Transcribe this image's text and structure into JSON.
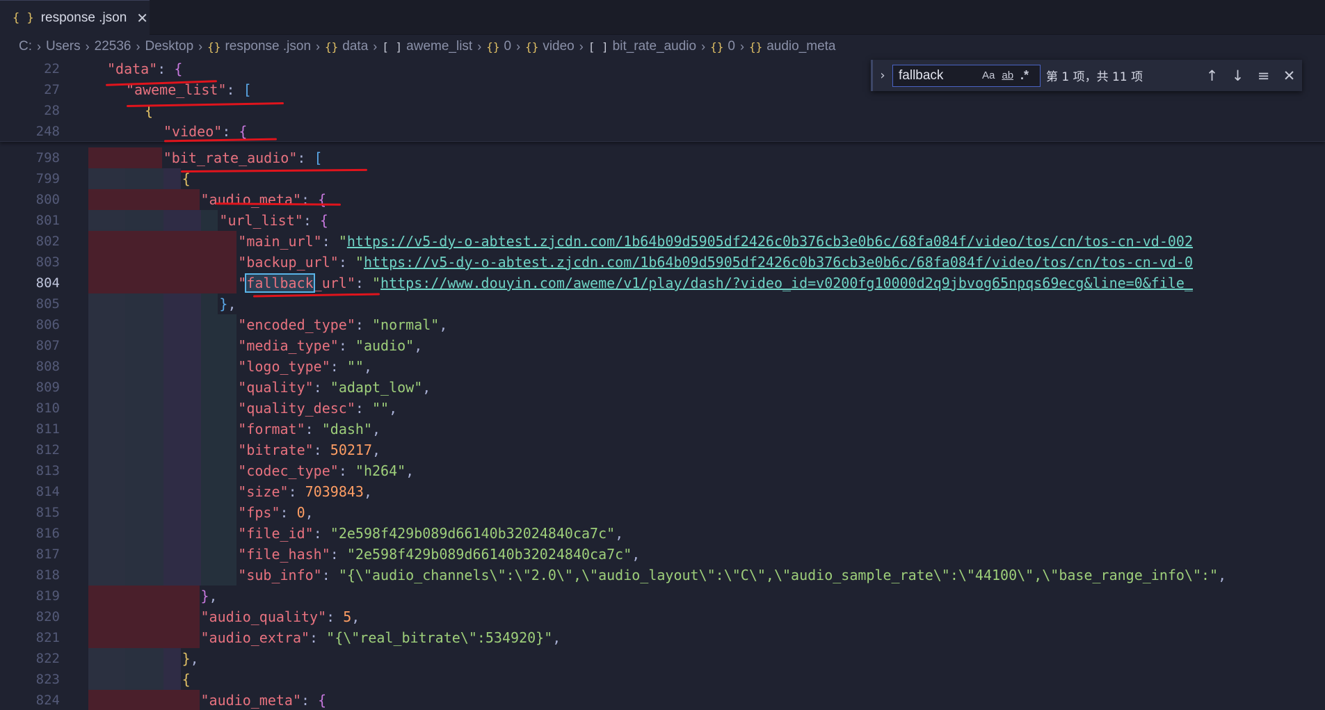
{
  "tab": {
    "title": "response .json",
    "icon": "{ }",
    "close": "✕"
  },
  "breadcrumb": [
    {
      "label": "C:",
      "icon": ""
    },
    {
      "label": "Users",
      "icon": ""
    },
    {
      "label": "22536",
      "icon": ""
    },
    {
      "label": "Desktop",
      "icon": ""
    },
    {
      "label": "response .json",
      "icon": "{}"
    },
    {
      "label": "data",
      "icon": "{}"
    },
    {
      "label": "aweme_list",
      "icon": "[ ]"
    },
    {
      "label": "0",
      "icon": "{}"
    },
    {
      "label": "video",
      "icon": "{}"
    },
    {
      "label": "bit_rate_audio",
      "icon": "[ ]"
    },
    {
      "label": "0",
      "icon": "{}"
    },
    {
      "label": "audio_meta",
      "icon": "{}"
    }
  ],
  "find": {
    "value": "fallback",
    "count": "第 1 项，共 11 项",
    "toggle": "›",
    "match_case": "Aa",
    "whole_word": "ab",
    "regex": ".*",
    "prev": "↑",
    "next": "↓",
    "select_all": "≡",
    "close": "✕"
  },
  "sticky_lines": [
    {
      "num": "22",
      "key": "data",
      "open": "{"
    },
    {
      "num": "27",
      "key": "aweme_list",
      "open": "["
    },
    {
      "num": "28",
      "open": "{"
    },
    {
      "num": "248",
      "key": "video",
      "open": "{"
    }
  ],
  "lines": [
    {
      "num": "798",
      "key": "bit_rate_audio",
      "open": "["
    },
    {
      "num": "799",
      "open": "{"
    },
    {
      "num": "800",
      "key": "audio_meta",
      "open": "{"
    },
    {
      "num": "801",
      "key": "url_list",
      "open": "{"
    },
    {
      "num": "802",
      "key": "main_url",
      "value": "https://v5-dy-o-abtest.zjcdn.com/1b64b09d5905df2426c0b376cb3e0b6c/68fa084f/video/tos/cn/tos-cn-vd-002"
    },
    {
      "num": "803",
      "key": "backup_url",
      "value": "https://v5-dy-o-abtest.zjcdn.com/1b64b09d5905df2426c0b376cb3e0b6c/68fa084f/video/tos/cn/tos-cn-vd-0"
    },
    {
      "num": "804",
      "key_match": "fallback",
      "key_rest": "_url",
      "value": "https://www.douyin.com/aweme/v1/play/dash/?video_id=v0200fg10000d2q9jbvog65npqs69ecg&line=0&file_"
    },
    {
      "num": "805",
      "close": "},"
    },
    {
      "num": "806",
      "key": "encoded_type",
      "value": "normal"
    },
    {
      "num": "807",
      "key": "media_type",
      "value": "audio"
    },
    {
      "num": "808",
      "key": "logo_type",
      "value": ""
    },
    {
      "num": "809",
      "key": "quality",
      "value": "adapt_low"
    },
    {
      "num": "810",
      "key": "quality_desc",
      "value": ""
    },
    {
      "num": "811",
      "key": "format",
      "value": "dash"
    },
    {
      "num": "812",
      "key": "bitrate",
      "number": "50217"
    },
    {
      "num": "813",
      "key": "codec_type",
      "value": "h264"
    },
    {
      "num": "814",
      "key": "size",
      "number": "7039843"
    },
    {
      "num": "815",
      "key": "fps",
      "number": "0"
    },
    {
      "num": "816",
      "key": "file_id",
      "value": "2e598f429b089d66140b32024840ca7c"
    },
    {
      "num": "817",
      "key": "file_hash",
      "value": "2e598f429b089d66140b32024840ca7c"
    },
    {
      "num": "818",
      "key": "sub_info",
      "value": "{\\\"audio_channels\\\":\\\"2.0\\\",\\\"audio_layout\\\":\\\"C\\\",\\\"audio_sample_rate\\\":\\\"44100\\\",\\\"base_range_info\\\":"
    },
    {
      "num": "819",
      "close": "},"
    },
    {
      "num": "820",
      "key": "audio_quality",
      "number": "5"
    },
    {
      "num": "821",
      "key": "audio_extra",
      "value": "{\\\"real_bitrate\\\":534920}"
    },
    {
      "num": "822",
      "close": "},"
    },
    {
      "num": "823",
      "open": "{"
    },
    {
      "num": "824",
      "key": "audio_meta",
      "open": "{"
    }
  ],
  "colors": {
    "background": "#1f2230",
    "key": "#e8727f",
    "string": "#9ecf7a",
    "url": "#6fd4c6",
    "number": "#ff9e64",
    "annotation": "#e0141c"
  }
}
